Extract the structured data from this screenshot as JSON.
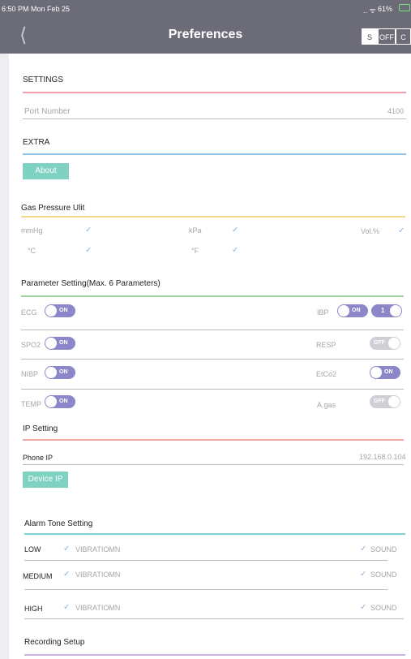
{
  "status": {
    "time": "6:50 PM  Mon Feb 25",
    "battery": "61%",
    "signal": "..ll"
  },
  "nav": {
    "title": "Preferences",
    "back_icon": "chevron-left-icon",
    "segments": [
      "S",
      "OFF",
      "C"
    ]
  },
  "settings": {
    "header": "SETTINGS",
    "port_label": "Port Number",
    "port_value": "4100",
    "extra_header": "EXTRA",
    "about_label": "About"
  },
  "gas": {
    "header": "Gas Pressure Ulit",
    "units": [
      {
        "label": "mmHg",
        "checked": true
      },
      {
        "label": "kPa",
        "checked": true
      },
      {
        "label": "Vol.%",
        "checked": true
      },
      {
        "label": "°C",
        "checked": true
      },
      {
        "label": "°F",
        "checked": true
      }
    ]
  },
  "params": {
    "header": "Parameter Setting(Max. 6 Parameters)",
    "rows": [
      {
        "left": "ECG",
        "left_state": "ON",
        "right": "IBP",
        "right_state": "ON",
        "extra": "1"
      },
      {
        "left": "SPO2",
        "left_state": "ON",
        "right": "RESP",
        "right_state": "OFF"
      },
      {
        "left": "NIBP",
        "left_state": "ON",
        "right": "EtCo2",
        "right_state": "ON"
      },
      {
        "left": "TEMP",
        "left_state": "ON",
        "right": "A.gas",
        "right_state": "OFF"
      }
    ]
  },
  "ip": {
    "header": "IP Setting",
    "phone_label": "Phone IP",
    "phone_value": "192.168.0.104",
    "device_button": "Device IP"
  },
  "alarm": {
    "header": "Alarm Tone Setting",
    "rows": [
      {
        "level": "LOW",
        "vib": "VIBRATIOMN",
        "sound": "SOUND"
      },
      {
        "level": "MEDIUM",
        "vib": "VIBRATIOMN",
        "sound": "SOUND"
      },
      {
        "level": "HIGH",
        "vib": "VIBRATIOMN",
        "sound": "SOUND"
      }
    ]
  },
  "recording": {
    "header": "Recording Setup"
  },
  "colors": {
    "settings_line": "#f2a0a6",
    "extra_line": "#8fc3e6",
    "gas_line": "#f4d98a",
    "param_line": "#9fd3a0",
    "ip_line": "#f2a7a2",
    "alarm_line": "#80cfd3",
    "recording_line": "#c9b3df",
    "toggle_on": "#8b87c8",
    "button": "#7fd1c2"
  }
}
